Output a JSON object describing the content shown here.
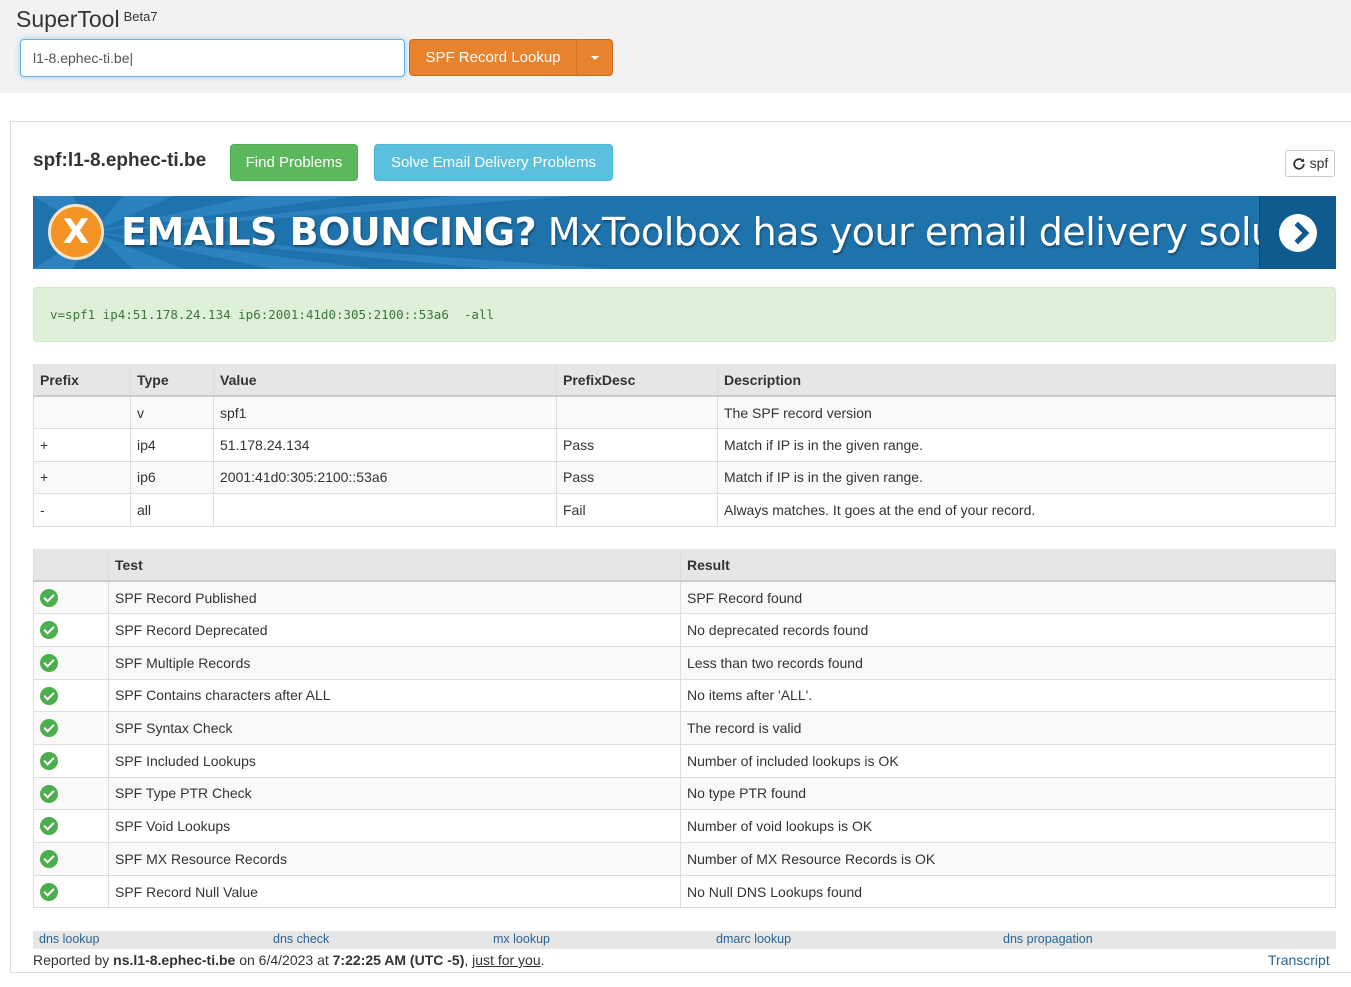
{
  "app": {
    "name": "SuperTool",
    "badge": "Beta7"
  },
  "search": {
    "value": "l1-8.ephec-ti.be",
    "button_label": "SPF Record Lookup"
  },
  "result": {
    "title": "spf:l1-8.ephec-ti.be",
    "find_problems_label": "Find Problems",
    "solve_label": "Solve Email Delivery Problems",
    "refresh_label": "spf"
  },
  "banner": {
    "logo": "X",
    "headline": "EMAILS BOUNCING?",
    "tagline": "MxToolbox has your email delivery solutions"
  },
  "record": "v=spf1 ip4:51.178.24.134 ip6:2001:41d0:305:2100::53a6  -all",
  "record_table": {
    "headers": [
      "Prefix",
      "Type",
      "Value",
      "PrefixDesc",
      "Description"
    ],
    "rows": [
      [
        "",
        "v",
        "spf1",
        "",
        "The SPF record version"
      ],
      [
        "+",
        "ip4",
        "51.178.24.134",
        "Pass",
        "Match if IP is in the given range."
      ],
      [
        "+",
        "ip6",
        "2001:41d0:305:2100::53a6",
        "Pass",
        "Match if IP is in the given range."
      ],
      [
        "-",
        "all",
        "",
        "Fail",
        "Always matches. It goes at the end of your record."
      ]
    ]
  },
  "test_table": {
    "headers": [
      "",
      "Test",
      "Result"
    ],
    "rows": [
      [
        "SPF Record Published",
        "SPF Record found"
      ],
      [
        "SPF Record Deprecated",
        "No deprecated records found"
      ],
      [
        "SPF Multiple Records",
        "Less than two records found"
      ],
      [
        "SPF Contains characters after ALL",
        "No items after 'ALL'."
      ],
      [
        "SPF Syntax Check",
        "The record is valid"
      ],
      [
        "SPF Included Lookups",
        "Number of included lookups is OK"
      ],
      [
        "SPF Type PTR Check",
        "No type PTR found"
      ],
      [
        "SPF Void Lookups",
        "Number of void lookups is OK"
      ],
      [
        "SPF MX Resource Records",
        "Number of MX Resource Records is OK"
      ],
      [
        "SPF Record Null Value",
        "No Null DNS Lookups found"
      ]
    ]
  },
  "footer_links": [
    "dns lookup",
    "dns check",
    "mx lookup",
    "dmarc lookup",
    "dns propagation"
  ],
  "reported": {
    "prefix": "Reported by ",
    "server": "ns.l1-8.ephec-ti.be",
    "on": " on 6/4/2023 at ",
    "time": "7:22:25 AM (UTC -5)",
    "sep": ", ",
    "link": "just for you",
    "end": "."
  },
  "transcript_label": "Transcript",
  "colors": {
    "accent_orange": "#e8822c",
    "success_green": "#5cb85c",
    "info_blue": "#5bc0de",
    "banner_blue": "#1f73ad"
  }
}
